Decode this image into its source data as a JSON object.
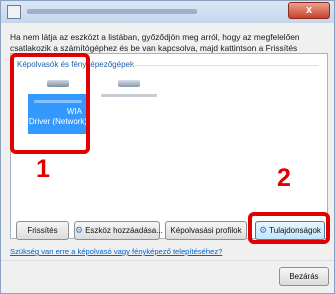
{
  "window": {
    "close_symbol": "x"
  },
  "instruction": "Ha nem látja az eszközt a listában, győződjön meg arról, hogy az megfelelően csatlakozik a számítógéphez és be van kapcsolva, majd kattintson a Frissítés gombra.",
  "device_list": {
    "group_header": "Képolvasók és fényképezőgépek",
    "devices": [
      {
        "label_line1": "WIA",
        "label_line2": "Driver (Network)",
        "selected": true,
        "icon": "scanner-icon"
      },
      {
        "label_line1": "",
        "label_line2": "",
        "selected": false,
        "icon": "scanner-icon"
      }
    ]
  },
  "callouts": {
    "marker_1": "1",
    "marker_2": "2",
    "color": "#e00000"
  },
  "buttons": {
    "refresh": "Frissítés",
    "add_device": "Eszköz hozzáadása...",
    "scan_profiles": "Képolvasási profilok",
    "properties": "Tulajdonságok",
    "close": "Bezárás"
  },
  "help_link": "Szükség van erre a képolvasó vagy fényképező telepítéséhez?",
  "colors": {
    "selection": "#3399ff",
    "link": "#0066cc",
    "group_header": "#1f5fb0"
  }
}
